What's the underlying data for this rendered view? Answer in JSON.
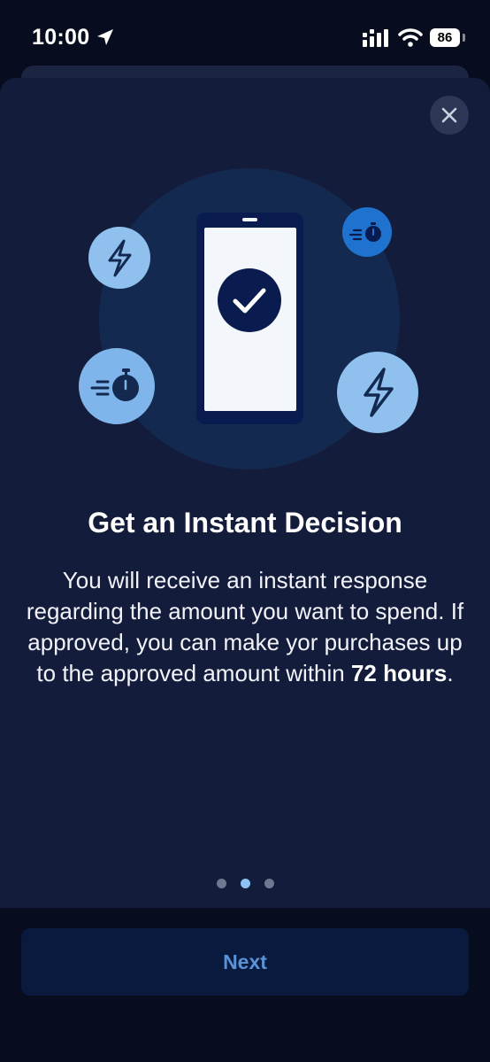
{
  "status_bar": {
    "time": "10:00",
    "battery": "86",
    "icons": [
      "location-arrow-icon",
      "cellular-signal-icon",
      "wifi-icon",
      "battery-icon"
    ]
  },
  "colors": {
    "sheet_background": "#141c3c",
    "page_background": "#070d1f",
    "accent": "#8cc2f5",
    "button_text": "#5b92d6"
  },
  "illustration": {
    "icons": [
      "phone-icon",
      "checkmark-icon",
      "lightning-icon",
      "stopwatch-icon"
    ]
  },
  "content": {
    "title": "Get an Instant Decision",
    "description_prefix": "You will receive an instant response regarding the amount you want to spend. If approved, you can make yor purchases up to the approved amount within ",
    "description_bold": "72 hours",
    "description_suffix": "."
  },
  "pagination": {
    "total": 3,
    "current": 2
  },
  "actions": {
    "next_label": "Next"
  }
}
